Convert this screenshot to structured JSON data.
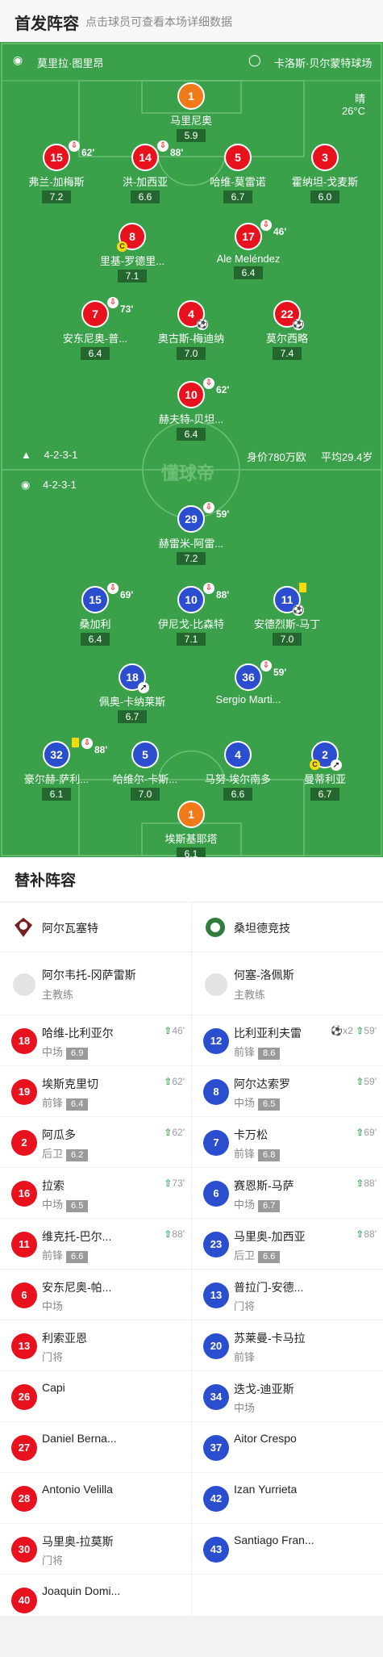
{
  "header": {
    "title": "首发阵容",
    "subtitle": "点击球员可查看本场详细数据"
  },
  "venue": {
    "referee": "莫里拉·图里昂",
    "stadium": "卡洛斯·贝尔蒙特球场",
    "weather": "晴",
    "temperature": "26°C"
  },
  "home": {
    "formation": "4-2-3-1",
    "players": [
      {
        "num": "1",
        "name": "马里尼奥",
        "rating": "5.9",
        "gk": true
      },
      {
        "num": "15",
        "name": "弗兰-加梅斯",
        "rating": "7.2",
        "sub_min": "62'"
      },
      {
        "num": "14",
        "name": "洪-加西亚",
        "rating": "6.6",
        "sub_min": "88'"
      },
      {
        "num": "5",
        "name": "哈维-莫雷诺",
        "rating": "6.7"
      },
      {
        "num": "3",
        "name": "霍纳坦-戈麦斯",
        "rating": "6.0"
      },
      {
        "num": "8",
        "name": "里基-罗德里...",
        "rating": "7.1",
        "captain": "C"
      },
      {
        "num": "17",
        "name": "Ale Meléndez",
        "rating": "6.4",
        "sub_min": "46'"
      },
      {
        "num": "7",
        "name": "安东尼奥-普...",
        "rating": "6.4",
        "sub_min": "73'"
      },
      {
        "num": "4",
        "name": "奥古斯-梅迪纳",
        "rating": "7.0"
      },
      {
        "num": "22",
        "name": "莫尔西略",
        "rating": "7.4"
      },
      {
        "num": "10",
        "name": "赫夫特-贝坦...",
        "rating": "6.4",
        "sub_min": "62'"
      }
    ]
  },
  "away": {
    "formation": "4-2-3-1",
    "value": "身价780万欧",
    "avg_age": "平均29.4岁",
    "players": [
      {
        "num": "29",
        "name": "赫雷米-阿雷...",
        "rating": "7.2",
        "sub_min": "59'"
      },
      {
        "num": "15",
        "name": "桑加利",
        "rating": "6.4",
        "sub_min": "69'"
      },
      {
        "num": "10",
        "name": "伊尼戈-比森特",
        "rating": "7.1",
        "sub_min": "88'"
      },
      {
        "num": "11",
        "name": "安德烈斯-马丁",
        "rating": "7.0"
      },
      {
        "num": "18",
        "name": "佩奥-卡纳莱斯",
        "rating": "6.7"
      },
      {
        "num": "36",
        "name": "Sergio Marti...",
        "rating": "",
        "sub_min": "59'"
      },
      {
        "num": "32",
        "name": "豪尔赫-萨利...",
        "rating": "6.1",
        "sub_min": "88'"
      },
      {
        "num": "5",
        "name": "哈维尔-卡斯...",
        "rating": "7.0"
      },
      {
        "num": "4",
        "name": "马努-埃尔南多",
        "rating": "6.6"
      },
      {
        "num": "2",
        "name": "曼蒂利亚",
        "rating": "6.7",
        "captain": "C"
      },
      {
        "num": "1",
        "name": "埃斯基耶塔",
        "rating": "6.1",
        "gk": true
      }
    ]
  },
  "watermark": "懂球帝",
  "bench": {
    "title": "替补阵容",
    "home_team": "阿尔瓦塞特",
    "away_team": "桑坦德竞技",
    "home_coach": {
      "name": "阿尔韦托-冈萨雷斯",
      "role": "主教练"
    },
    "away_coach": {
      "name": "何塞-洛佩斯",
      "role": "主教练"
    },
    "home_subs": [
      {
        "num": "18",
        "name": "哈维-比利亚尔",
        "pos": "中场",
        "rating": "6.9",
        "event": "46'"
      },
      {
        "num": "19",
        "name": "埃斯克里切",
        "pos": "前锋",
        "rating": "6.4",
        "event": "62'"
      },
      {
        "num": "2",
        "name": "阿瓜多",
        "pos": "后卫",
        "rating": "6.2",
        "event": "62'"
      },
      {
        "num": "16",
        "name": "拉索",
        "pos": "中场",
        "rating": "6.5",
        "event": "73'"
      },
      {
        "num": "11",
        "name": "维克托-巴尔...",
        "pos": "前锋",
        "rating": "6.6",
        "event": "88'"
      },
      {
        "num": "6",
        "name": "安东尼奥-帕...",
        "pos": "中场",
        "rating": "",
        "event": ""
      },
      {
        "num": "13",
        "name": "利索亚恩",
        "pos": "门将",
        "rating": "",
        "event": ""
      },
      {
        "num": "26",
        "name": "Capi",
        "pos": "",
        "rating": "",
        "event": ""
      },
      {
        "num": "27",
        "name": "Daniel Berna...",
        "pos": "",
        "rating": "",
        "event": ""
      },
      {
        "num": "28",
        "name": "Antonio Velilla",
        "pos": "",
        "rating": "",
        "event": ""
      },
      {
        "num": "30",
        "name": "马里奥-拉莫斯",
        "pos": "门将",
        "rating": "",
        "event": ""
      },
      {
        "num": "40",
        "name": "Joaquin Domi...",
        "pos": "",
        "rating": "",
        "event": ""
      }
    ],
    "away_subs": [
      {
        "num": "12",
        "name": "比利亚利夫雷",
        "pos": "前锋",
        "rating": "8.6",
        "event": "59'",
        "goals": "x2"
      },
      {
        "num": "8",
        "name": "阿尔达索罗",
        "pos": "中场",
        "rating": "6.5",
        "event": "59'"
      },
      {
        "num": "7",
        "name": "卡万松",
        "pos": "前锋",
        "rating": "6.8",
        "event": "69'"
      },
      {
        "num": "6",
        "name": "赛恩斯-马萨",
        "pos": "中场",
        "rating": "6.7",
        "event": "88'"
      },
      {
        "num": "23",
        "name": "马里奥-加西亚",
        "pos": "后卫",
        "rating": "6.6",
        "event": "88'"
      },
      {
        "num": "13",
        "name": "普拉门-安德...",
        "pos": "门将",
        "rating": "",
        "event": ""
      },
      {
        "num": "20",
        "name": "苏莱曼-卡马拉",
        "pos": "前锋",
        "rating": "",
        "event": ""
      },
      {
        "num": "34",
        "name": "迭戈-迪亚斯",
        "pos": "中场",
        "rating": "",
        "event": ""
      },
      {
        "num": "37",
        "name": "Aitor Crespo",
        "pos": "",
        "rating": "",
        "event": ""
      },
      {
        "num": "42",
        "name": "Izan Yurrieta",
        "pos": "",
        "rating": "",
        "event": ""
      },
      {
        "num": "43",
        "name": "Santiago Fran...",
        "pos": "",
        "rating": "",
        "event": ""
      }
    ]
  }
}
